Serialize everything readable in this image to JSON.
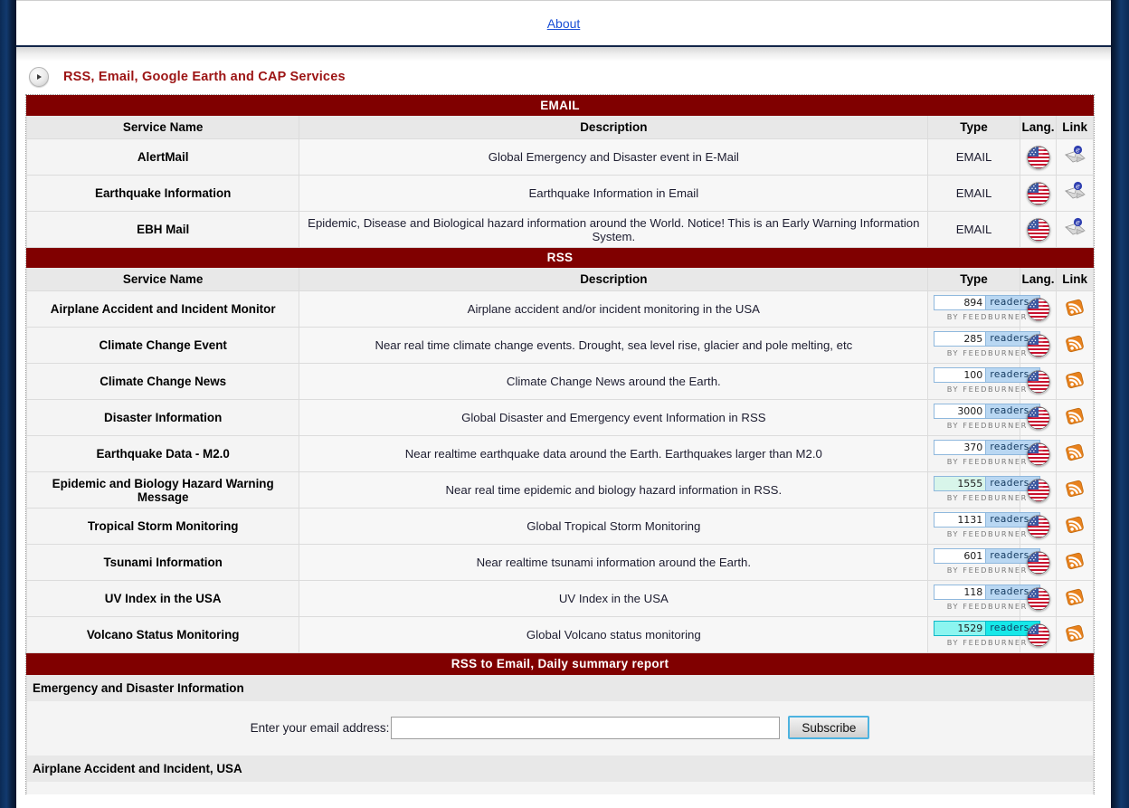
{
  "topnav": {
    "about_label": "About"
  },
  "heading": {
    "icon": "play-circle-icon",
    "title": "RSS, Email, Google Earth and CAP Services"
  },
  "tables": {
    "email": {
      "bar_label": "EMAIL",
      "columns": [
        "Service Name",
        "Description",
        "Type",
        "Lang.",
        "Link"
      ],
      "rows": [
        {
          "name": "AlertMail",
          "description": "Global Emergency and Disaster event in E-Mail",
          "type": "EMAIL",
          "lang_icon": "us-flag-icon",
          "link_icon": "email-envelope-icon"
        },
        {
          "name": "Earthquake Information",
          "description": "Earthquake Information in Email",
          "type": "EMAIL",
          "lang_icon": "us-flag-icon",
          "link_icon": "email-envelope-icon"
        },
        {
          "name": "EBH Mail",
          "description": "Epidemic, Disease and Biological hazard information around the World. Notice! This is an Early Warning Information System.",
          "type": "EMAIL",
          "lang_icon": "us-flag-icon",
          "link_icon": "email-envelope-icon"
        }
      ]
    },
    "rss": {
      "bar_label": "RSS",
      "columns": [
        "Service Name",
        "Description",
        "Type",
        "Lang.",
        "Link"
      ],
      "badge_word": "readers",
      "badge_by": "BY FEEDBURNER",
      "rows": [
        {
          "name": "Airplane Accident and Incident Monitor",
          "description": "Airplane accident and/or incident monitoring in the USA",
          "readers": "894",
          "highlight": "none",
          "lang_icon": "us-flag-icon",
          "link_icon": "rss-feed-icon"
        },
        {
          "name": "Climate Change Event",
          "description": "Near real time climate change events. Drought, sea level rise, glacier and pole melting, etc",
          "readers": "285",
          "highlight": "none",
          "lang_icon": "us-flag-icon",
          "link_icon": "rss-feed-icon"
        },
        {
          "name": "Climate Change News",
          "description": "Climate Change News around the Earth.",
          "readers": "100",
          "highlight": "none",
          "lang_icon": "us-flag-icon",
          "link_icon": "rss-feed-icon"
        },
        {
          "name": "Disaster Information",
          "description": "Global Disaster and Emergency event Information in RSS",
          "readers": "3000",
          "highlight": "none",
          "lang_icon": "us-flag-icon",
          "link_icon": "rss-feed-icon"
        },
        {
          "name": "Earthquake Data - M2.0",
          "description": "Near realtime earthquake data around the Earth. Earthquakes larger than M2.0",
          "readers": "370",
          "highlight": "none",
          "lang_icon": "us-flag-icon",
          "link_icon": "rss-feed-icon"
        },
        {
          "name": "Epidemic and Biology Hazard Warning Message",
          "description": "Near real time epidemic and biology hazard information in RSS.",
          "readers": "1555",
          "highlight": "mint",
          "lang_icon": "us-flag-icon",
          "link_icon": "rss-feed-icon"
        },
        {
          "name": "Tropical Storm Monitoring",
          "description": "Global Tropical Storm Monitoring",
          "readers": "1131",
          "highlight": "none",
          "lang_icon": "us-flag-icon",
          "link_icon": "rss-feed-icon"
        },
        {
          "name": "Tsunami Information",
          "description": "Near realtime tsunami information around the Earth.",
          "readers": "601",
          "highlight": "none",
          "lang_icon": "us-flag-icon",
          "link_icon": "rss-feed-icon"
        },
        {
          "name": "UV Index in the USA",
          "description": "UV Index in the USA",
          "readers": "118",
          "highlight": "none",
          "lang_icon": "us-flag-icon",
          "link_icon": "rss-feed-icon"
        },
        {
          "name": "Volcano Status Monitoring",
          "description": "Global Volcano status monitoring",
          "readers": "1529",
          "highlight": "cyan",
          "lang_icon": "us-flag-icon",
          "link_icon": "rss-feed-icon"
        }
      ]
    }
  },
  "rss_to_email": {
    "bar_label": "RSS to Email, Daily summary report",
    "feeds": [
      {
        "label": "Emergency and Disaster Information",
        "field_label": "Enter your email address:",
        "input_value": "",
        "input_placeholder": "",
        "button_label": "Subscribe"
      },
      {
        "label": "Airplane Accident and Incident, USA"
      }
    ]
  },
  "colors": {
    "bar_red": "#800000",
    "heading_red": "#9c1414",
    "link_blue": "#1a4fd6",
    "frame_navy": "#0a1f3f",
    "badge_blue": "#b9d7f2",
    "badge_cyan": "#16e8e8",
    "rss_orange": "#e8821e"
  }
}
